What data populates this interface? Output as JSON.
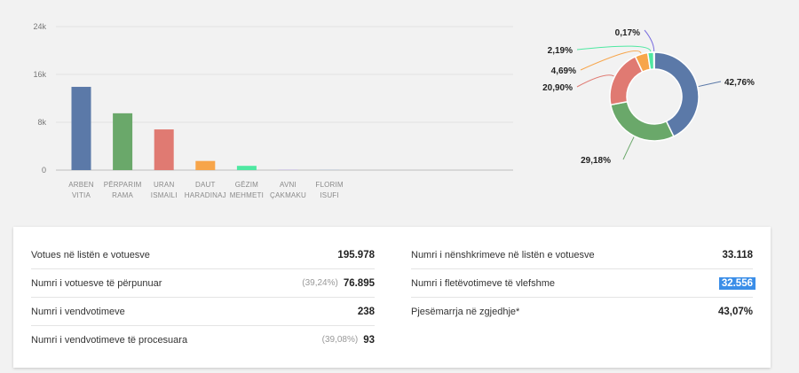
{
  "chart_data": [
    {
      "type": "bar",
      "categories": [
        [
          "ARBEN",
          "VITIA"
        ],
        [
          "PËRPARIM",
          "RAMA"
        ],
        [
          "URAN",
          "ISMAILI"
        ],
        [
          "DAUT",
          "HARADINAJ"
        ],
        [
          "GËZIM",
          "MEHMETI"
        ],
        [
          "AVNI",
          "ÇAKMAKU"
        ],
        [
          "FLORIM",
          "ISUFI"
        ]
      ],
      "values": [
        13922,
        9500,
        6804,
        1527,
        713,
        55,
        35
      ],
      "colors": [
        "#5b79a8",
        "#6aa86a",
        "#e07a72",
        "#f7a54a",
        "#4fe8a2",
        "#b9a6e6",
        "#9fb8d6"
      ],
      "ylim": [
        0,
        24000
      ],
      "yticks": [
        0,
        8000,
        16000,
        24000
      ],
      "ytick_labels": [
        "0",
        "8k",
        "16k",
        "24k"
      ],
      "grid": true,
      "title": "",
      "xlabel": "",
      "ylabel": ""
    },
    {
      "type": "pie",
      "donut": true,
      "values": [
        42.76,
        29.18,
        20.9,
        4.69,
        2.19,
        0.17
      ],
      "labels": [
        "42,76%",
        "29,18%",
        "20,90%",
        "4,69%",
        "2,19%",
        "0,17%"
      ],
      "colors": [
        "#5b79a8",
        "#6aa86a",
        "#e07a72",
        "#f7a54a",
        "#4fe8a2",
        "#7b6fe0"
      ]
    }
  ],
  "stats": {
    "left": [
      {
        "label": "Votues në listën e votuesve",
        "pct": "",
        "value": "195.978"
      },
      {
        "label": "Numri i votuesve të përpunuar",
        "pct": "(39,24%)",
        "value": "76.895"
      },
      {
        "label": "Numri i vendvotimeve",
        "pct": "",
        "value": "238"
      },
      {
        "label": "Numri i vendvotimeve të procesuara",
        "pct": "(39,08%)",
        "value": "93"
      }
    ],
    "right": [
      {
        "label": "Numri i nënshkrimeve në listën e votuesve",
        "pct": "",
        "value": "33.118"
      },
      {
        "label": "Numri i fletëvotimeve të vlefshme",
        "pct": "",
        "value": "32.556"
      },
      {
        "label": "Pjesëmarrja në zgjedhje*",
        "pct": "",
        "value": "43,07%"
      }
    ]
  }
}
